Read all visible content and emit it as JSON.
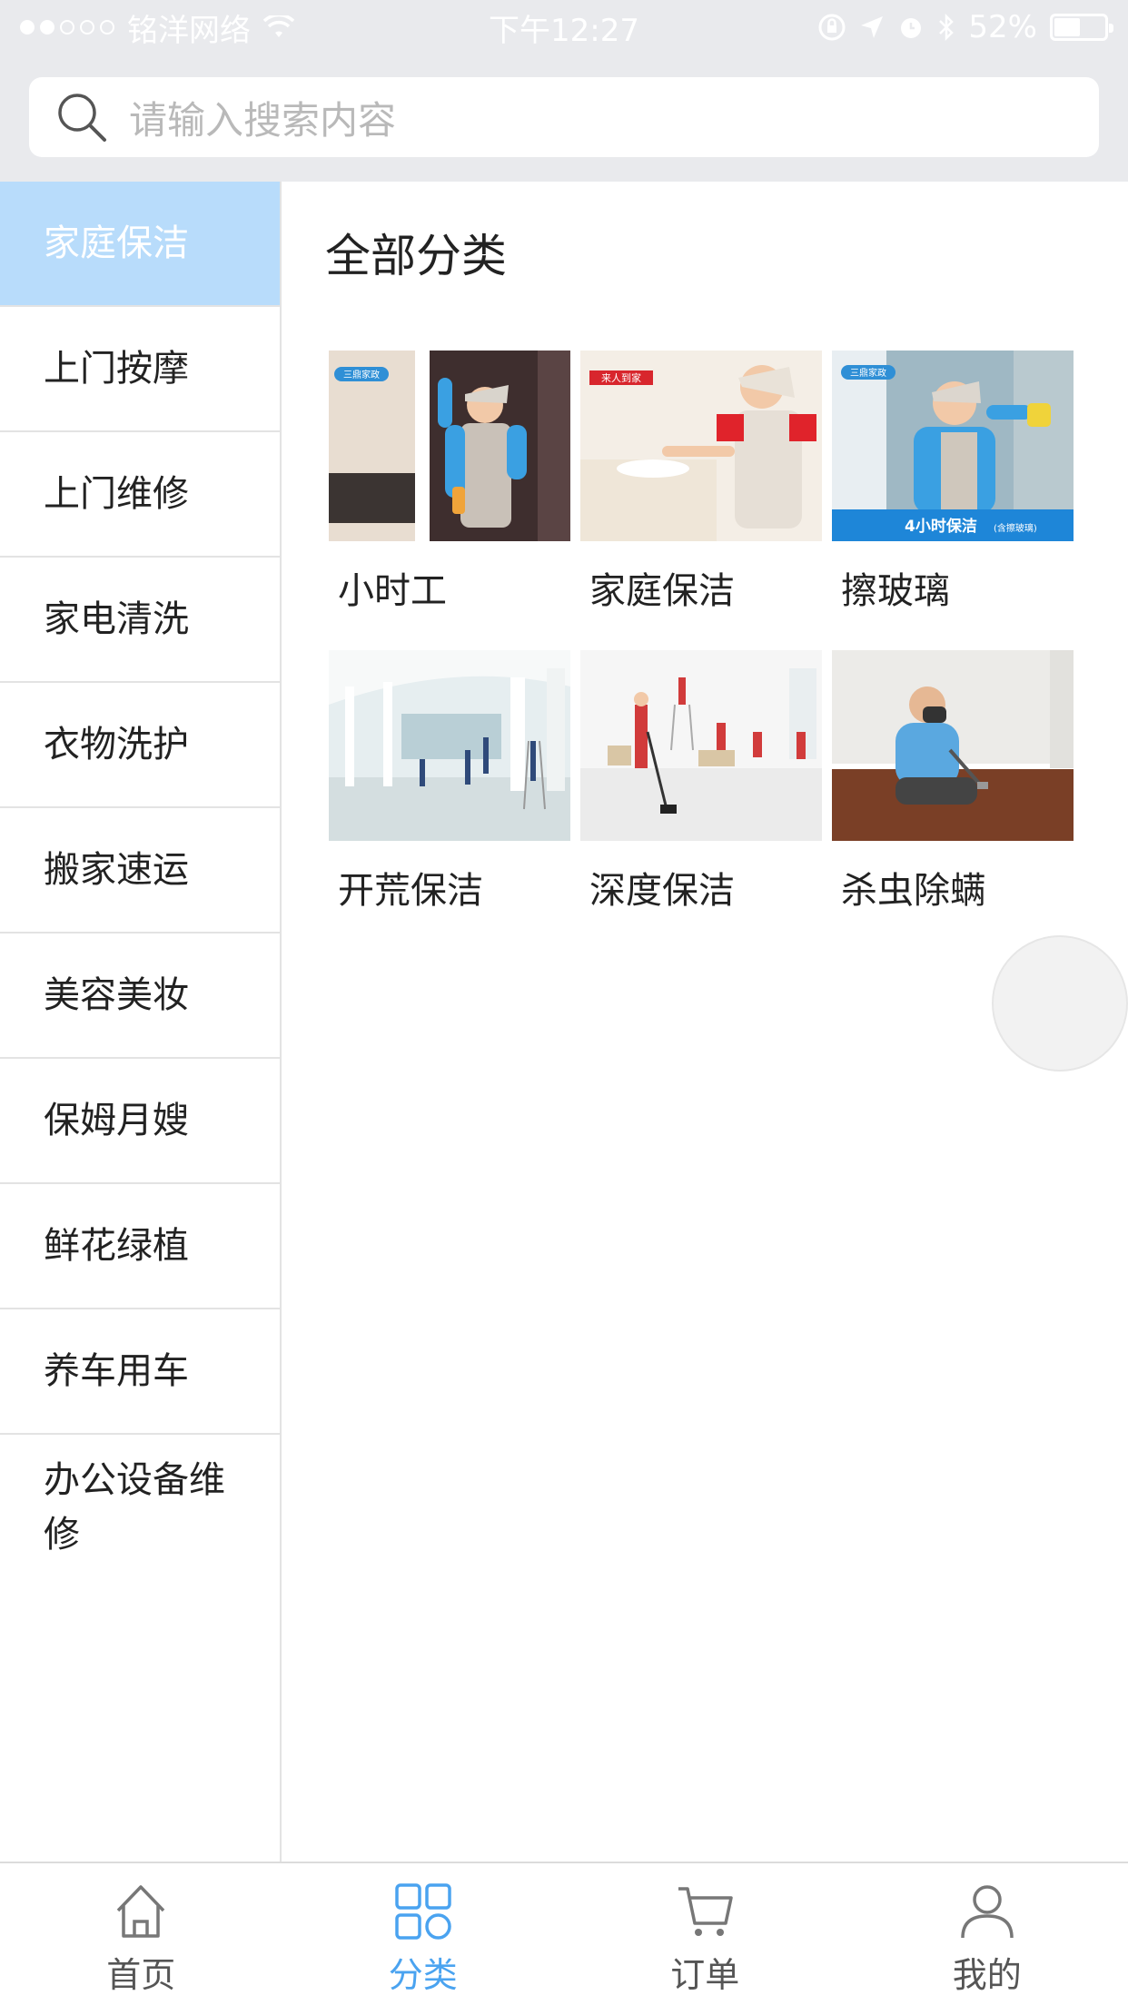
{
  "status_bar": {
    "carrier": "铭洋网络",
    "time": "下午12:27",
    "battery": "52%",
    "battery_level": 0.52
  },
  "search": {
    "placeholder": "请输入搜索内容"
  },
  "sidebar": {
    "items": [
      {
        "label": "家庭保洁",
        "active": true
      },
      {
        "label": "上门按摩"
      },
      {
        "label": "上门维修"
      },
      {
        "label": "家电清洗"
      },
      {
        "label": "衣物洗护"
      },
      {
        "label": "搬家速运"
      },
      {
        "label": "美容美妆"
      },
      {
        "label": "保姆月嫂"
      },
      {
        "label": "鲜花绿植"
      },
      {
        "label": "养车用车"
      },
      {
        "label": "办公设备维修"
      }
    ]
  },
  "main": {
    "title": "全部分类",
    "tiles": [
      {
        "label": "小时工",
        "logo_text": "三鼎家政"
      },
      {
        "label": "家庭保洁",
        "logo_text": "来人到家"
      },
      {
        "label": "擦玻璃",
        "logo_text": "三鼎家政",
        "banner_text": "4小时保洁",
        "banner_sub": "(含擦玻璃)"
      },
      {
        "label": "开荒保洁"
      },
      {
        "label": "深度保洁"
      },
      {
        "label": "杀虫除螨"
      }
    ]
  },
  "tabbar": {
    "items": [
      {
        "label": "首页",
        "icon": "home-icon"
      },
      {
        "label": "分类",
        "icon": "grid-icon",
        "active": true
      },
      {
        "label": "订单",
        "icon": "cart-icon"
      },
      {
        "label": "我的",
        "icon": "user-icon"
      }
    ]
  },
  "colors": {
    "accent": "#4aa3f0",
    "sidebar_active_bg": "#b8dcfb",
    "header_bg": "#e9eaed"
  }
}
